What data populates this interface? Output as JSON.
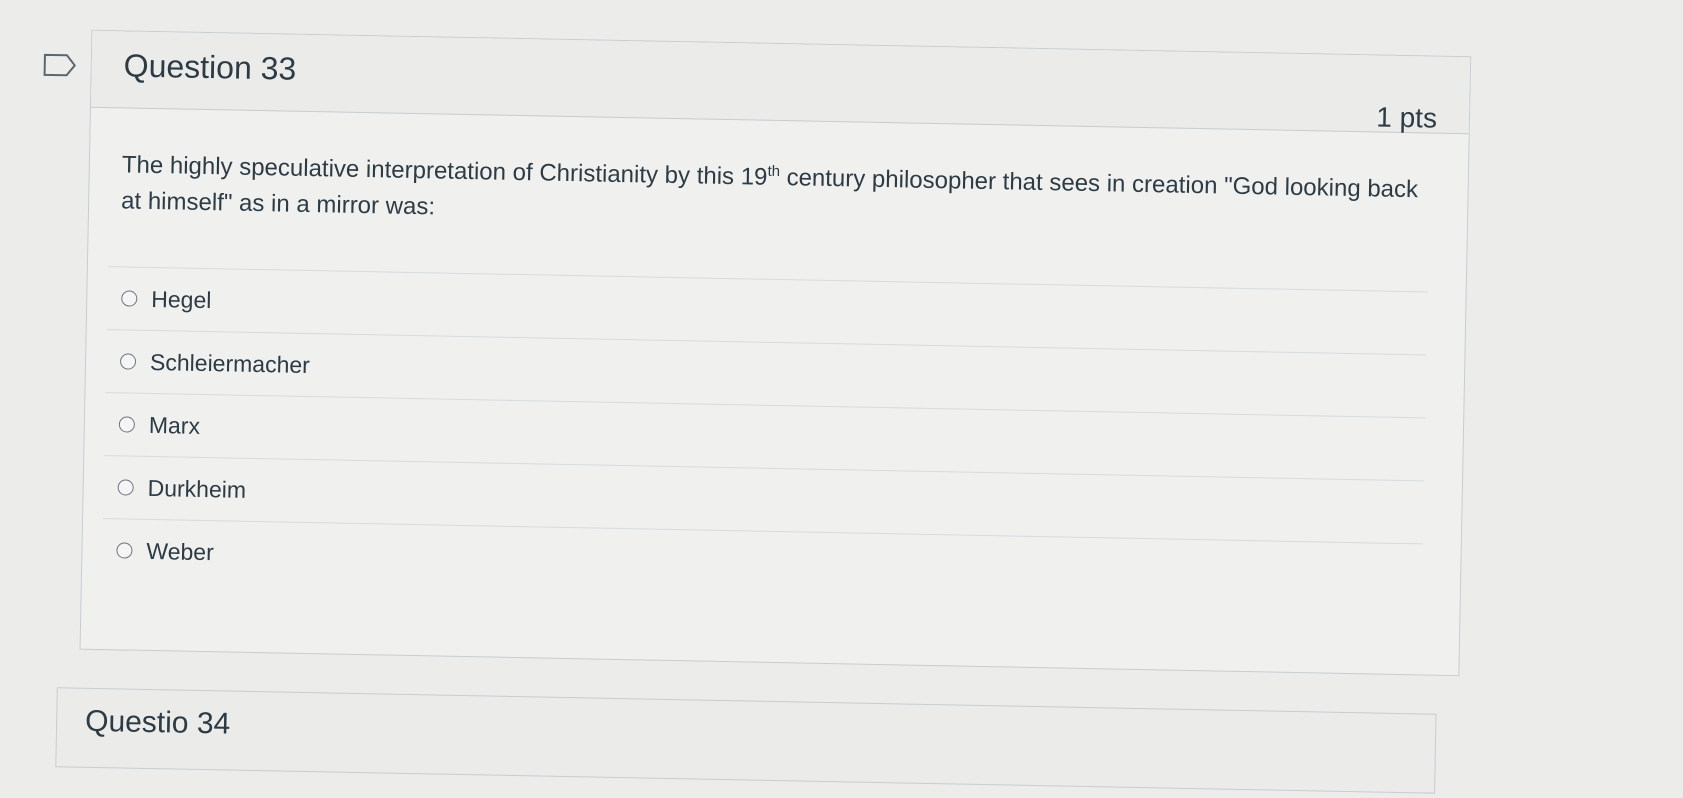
{
  "question": {
    "title": "Question 33",
    "points": "1 pts",
    "text_before": "The highly speculative interpretation of Christianity by this 19",
    "text_sup": "th",
    "text_after": " century philosopher that sees in creation \"God looking back at himself\" as in a mirror was:",
    "answers": [
      {
        "label": "Hegel"
      },
      {
        "label": "Schleiermacher"
      },
      {
        "label": "Marx"
      },
      {
        "label": "Durkheim"
      },
      {
        "label": "Weber"
      }
    ]
  },
  "next_question": {
    "title": "Questio 34"
  },
  "colors": {
    "background": "#ececeb",
    "text": "#2d3b45",
    "border": "#c7cdd1"
  }
}
